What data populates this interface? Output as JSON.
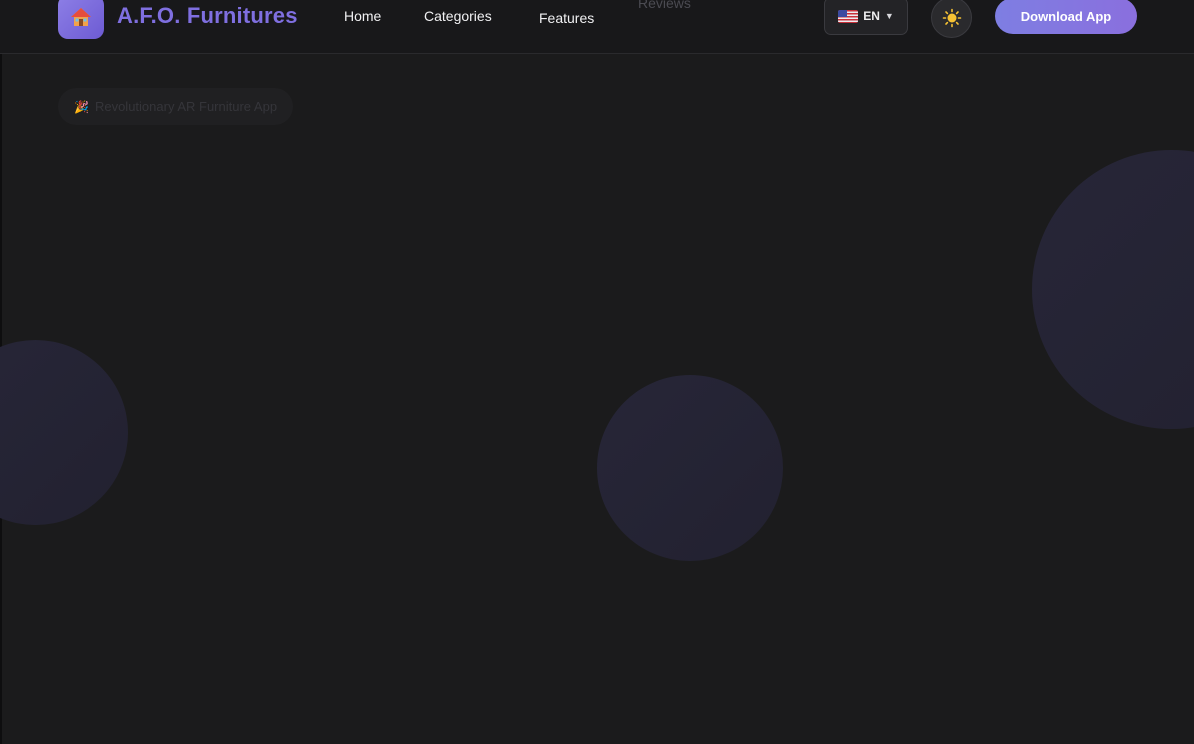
{
  "brand": {
    "name": "A.F.O. Furnitures",
    "logo_icon": "house-icon",
    "accent_color": "#7f6fe0"
  },
  "nav": {
    "items": [
      {
        "label": "Home"
      },
      {
        "label": "Categories"
      },
      {
        "label": "Features"
      },
      {
        "label": "Reviews"
      }
    ]
  },
  "language": {
    "flag_icon": "us-flag-icon",
    "code": "EN",
    "caret": "▼"
  },
  "theme_toggle": {
    "icon": "sun-icon"
  },
  "download": {
    "label": "Download App",
    "color": "#8378e0"
  },
  "hero": {
    "badge_icon": "party-popper-icon",
    "badge_text": "Revolutionary AR Furniture App"
  },
  "colors": {
    "background": "#1b1b1c",
    "header": "#18181a",
    "circle": "#252435"
  }
}
